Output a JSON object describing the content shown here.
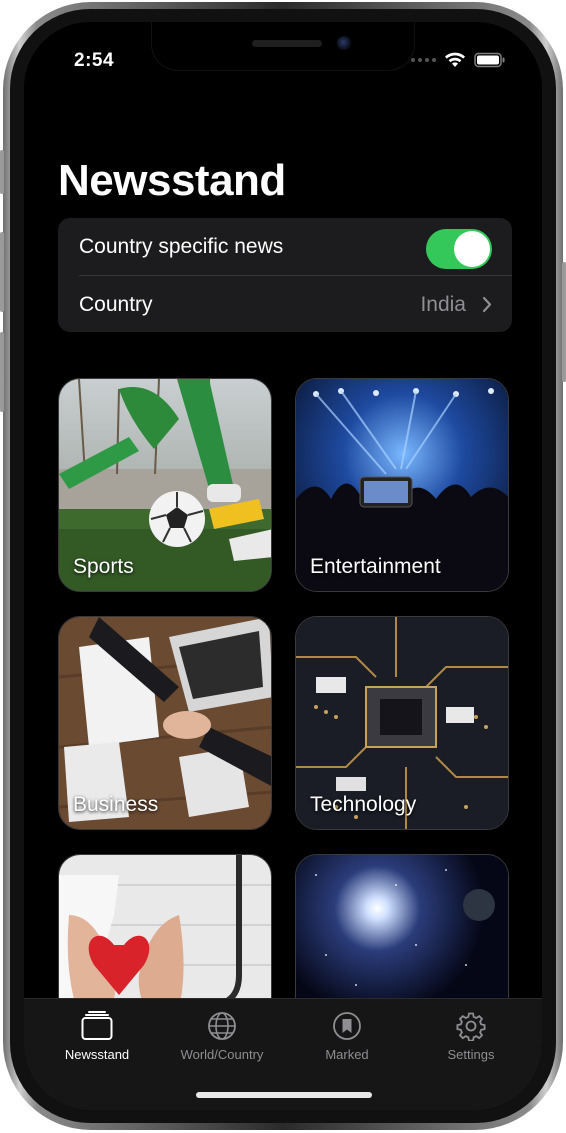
{
  "status_bar": {
    "time": "2:54"
  },
  "page": {
    "title": "Newsstand"
  },
  "settings": {
    "country_specific": {
      "label": "Country specific news",
      "enabled": true
    },
    "country": {
      "label": "Country",
      "value": "India"
    }
  },
  "categories": [
    {
      "label": "Sports",
      "image": "soccer-image"
    },
    {
      "label": "Entertainment",
      "image": "concert-image"
    },
    {
      "label": "Business",
      "image": "handshake-image"
    },
    {
      "label": "Technology",
      "image": "circuit-board-image"
    },
    {
      "label": "",
      "image": "health-heart-image"
    },
    {
      "label": "",
      "image": "space-image"
    }
  ],
  "tab_bar": {
    "items": [
      {
        "label": "Newsstand",
        "icon": "newsstand-icon",
        "active": true
      },
      {
        "label": "World/Country",
        "icon": "globe-icon",
        "active": false
      },
      {
        "label": "Marked",
        "icon": "bookmark-icon",
        "active": false
      },
      {
        "label": "Settings",
        "icon": "gear-icon",
        "active": false
      }
    ]
  },
  "colors": {
    "accent_green": "#34c759",
    "group_bg": "#1c1c1e",
    "secondary_text": "#8e8e93"
  }
}
